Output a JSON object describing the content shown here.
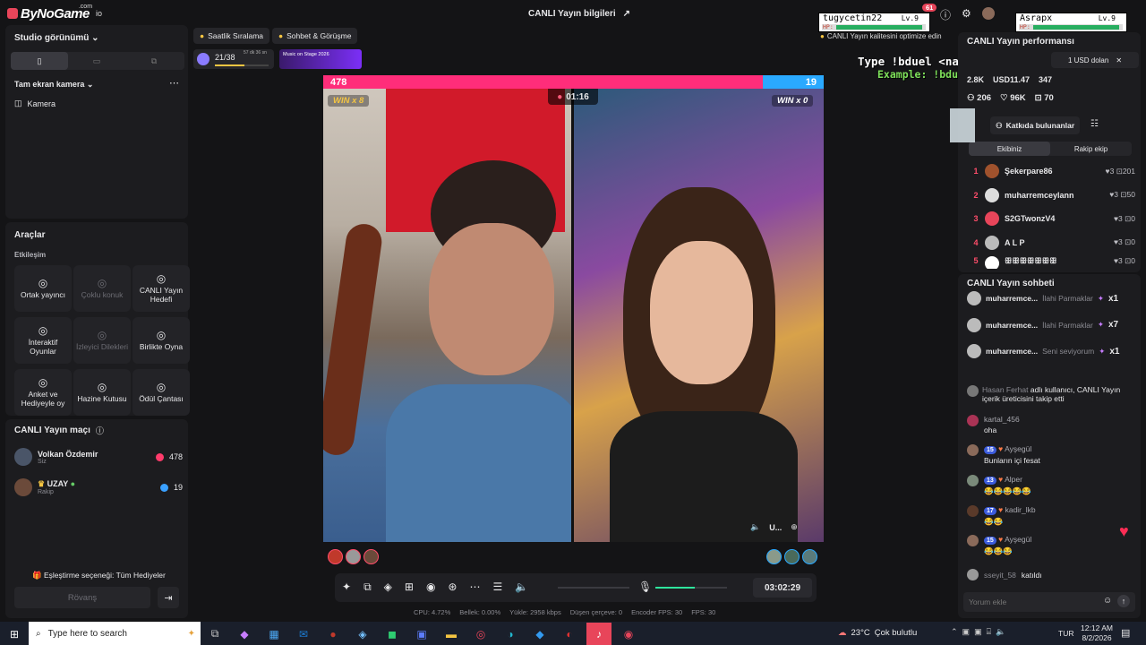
{
  "app": {
    "logo": "ByNoGame",
    "logo_sub": ".com",
    "studio_label": "io",
    "title": "CANLI Yayın bilgileri"
  },
  "left": {
    "studio_view": "Studio görünümü",
    "camera_section": "Tam ekran kamera",
    "camera_item": "Kamera",
    "tools_title": "Araçlar",
    "interaction": "Etkileşim",
    "tools": [
      {
        "label": "Ortak yayıncı",
        "icon": "link-icon"
      },
      {
        "label": "Çoklu konuk",
        "icon": "guests-icon"
      },
      {
        "label": "CANLI Yayın Hedefi",
        "icon": "target-icon"
      },
      {
        "label": "İnteraktif Oyunlar",
        "icon": "gamepad-icon"
      },
      {
        "label": "İzleyici Dilekleri",
        "icon": "wish-icon"
      },
      {
        "label": "Birlikte Oyna",
        "icon": "joystick-icon"
      },
      {
        "label": "Anket ve Hediyeyle oy",
        "icon": "poll-icon"
      },
      {
        "label": "Hazine Kutusu",
        "icon": "chest-icon"
      },
      {
        "label": "Ödül Çantası",
        "icon": "bag-icon"
      }
    ],
    "match_title": "CANLI Yayın maçı",
    "players": [
      {
        "name": "Volkan Özdemir",
        "role": "Siz",
        "score": "478"
      },
      {
        "name": "UZAY",
        "role": "Rakip",
        "score": "19"
      }
    ],
    "match_option": "Eşleştirme seçeneği: Tüm Hediyeler",
    "rematch": "Rövanş"
  },
  "top": {
    "tab_hourly": "Saatlik Sıralama",
    "tab_chat": "Sohbet & Görüşme",
    "progress": "21/38",
    "progress_fill": 0.55,
    "timer_small": "57 dk 36 sn",
    "banner": "Music on Stage 2026",
    "overlay_user1": "tugycetin22",
    "overlay_lv1": "Lv.9",
    "overlay_user2": "Asrapx",
    "overlay_lv2": "Lv.9",
    "notif_count": "61",
    "quality_tip": "CANLI Yayın kalitesini optimize edin",
    "hp": "HP:",
    "overlay_type": "Type !bduel <name> to play",
    "overlay_example": "Example: !bduel Asrapx",
    "usd_label": "1 USD dolan"
  },
  "battle": {
    "score_left": "478",
    "score_right": "19",
    "timer": "01:16",
    "win_left": "WIN x 8",
    "win_right": "WIN x 0",
    "guest_tag": "U..."
  },
  "controls": {
    "time": "03:02:29",
    "volume_fill": 0.55,
    "stats": [
      "CPU: 4.72%",
      "Bellek: 0.00%",
      "Yükle: 2958 kbps",
      "Düşen çerçeve: 0",
      "Encoder FPS: 30",
      "FPS: 30"
    ]
  },
  "right": {
    "perf_title": "CANLI Yayın performansı",
    "stat_a": "2.8K",
    "stat_b": "USD11.47",
    "stat_c": "347",
    "stat_d": "206",
    "stat_e": "96K",
    "stat_f": "70",
    "contributors": "Katkıda bulunanlar",
    "tab_team": "Ekibiniz",
    "tab_opp": "Rakip ekip",
    "ranking": [
      {
        "n": "1",
        "name": "Şekerpare86",
        "hearts": "3",
        "gifts": "201"
      },
      {
        "n": "2",
        "name": "muharremceylann",
        "hearts": "3",
        "gifts": "50"
      },
      {
        "n": "3",
        "name": "S2GTwonzV4",
        "hearts": "3",
        "gifts": "0"
      },
      {
        "n": "4",
        "name": "A L P",
        "hearts": "3",
        "gifts": "0"
      },
      {
        "n": "5",
        "name": "ꕥꕥꕥꕥꕥꕥꕥ",
        "hearts": "3",
        "gifts": "0"
      }
    ],
    "chat_title": "CANLI Yayın sohbeti",
    "gifts": [
      {
        "user": "muharremce...",
        "gift": "İlahi Parmaklar",
        "count": "x1"
      },
      {
        "user": "muharremce...",
        "gift": "İlahi Parmaklar",
        "count": "x7"
      },
      {
        "user": "muharremce...",
        "gift": "Seni seviyorum",
        "count": "x1"
      }
    ],
    "follow_user": "Hasan Ferhat",
    "follow_text": "adlı kullanıcı, CANLI Yayın içerik üreticisini takip etti",
    "comments": [
      {
        "user": "kartal_456",
        "text": "oha",
        "level": ""
      },
      {
        "user": "Ayşegül",
        "text": "Bunların içi fesat",
        "level": "15"
      },
      {
        "user": "Alper",
        "text": "😂😂😂😂😂",
        "level": "13"
      },
      {
        "user": "kadir_lkb",
        "text": "😂😂",
        "level": "17"
      },
      {
        "user": "Ayşegül",
        "text": "😂😂😂",
        "level": "15"
      }
    ],
    "joined_user": "sseyit_58",
    "joined_text": "katıldı",
    "comment_placeholder": "Yorum ekle"
  },
  "taskbar": {
    "search": "Type here to search",
    "weather_temp": "23°C",
    "weather_text": "Çok bulutlu",
    "lang": "TUR",
    "time": "12:12 AM",
    "date": "8/2/2026"
  }
}
